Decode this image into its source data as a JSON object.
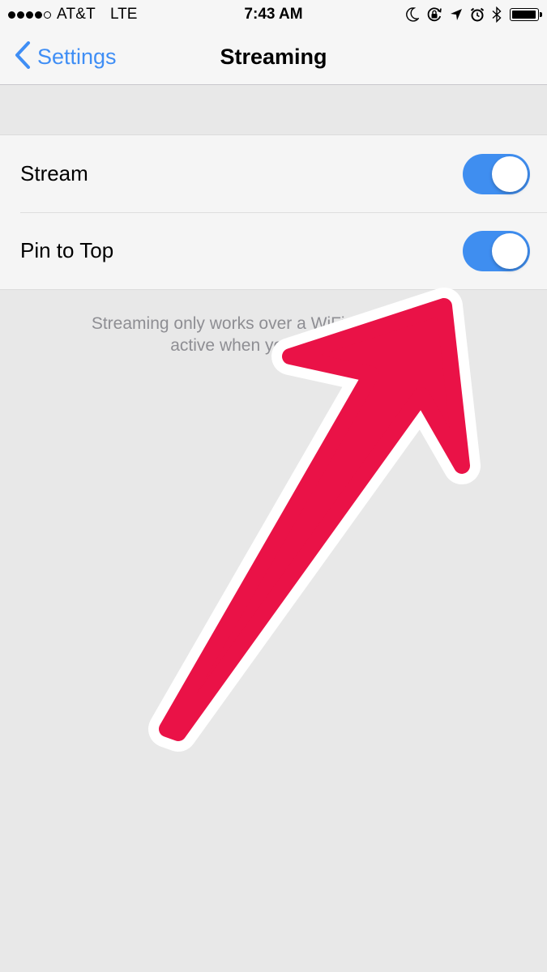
{
  "status_bar": {
    "carrier": "AT&T",
    "network": "LTE",
    "time": "7:43 AM",
    "signal_bars_filled": 4,
    "signal_bars_total": 5,
    "battery_level": 0.95,
    "icons": [
      "moon-icon",
      "orientation-lock-icon",
      "location-arrow-icon",
      "alarm-clock-icon",
      "bluetooth-icon"
    ]
  },
  "nav": {
    "back_label": "Settings",
    "title": "Streaming"
  },
  "settings": [
    {
      "label": "Stream",
      "enabled": true
    },
    {
      "label": "Pin to Top",
      "enabled": true
    }
  ],
  "footer_note_lines": [
    "Streaming only works over a WiFi netw… is only",
    "active when you are at th…"
  ],
  "colors": {
    "accent": "#3f8ef5",
    "toggle_on": "#3f8ef0",
    "annotation_arrow": "#ea1247",
    "annotation_outline": "#ffffff"
  }
}
